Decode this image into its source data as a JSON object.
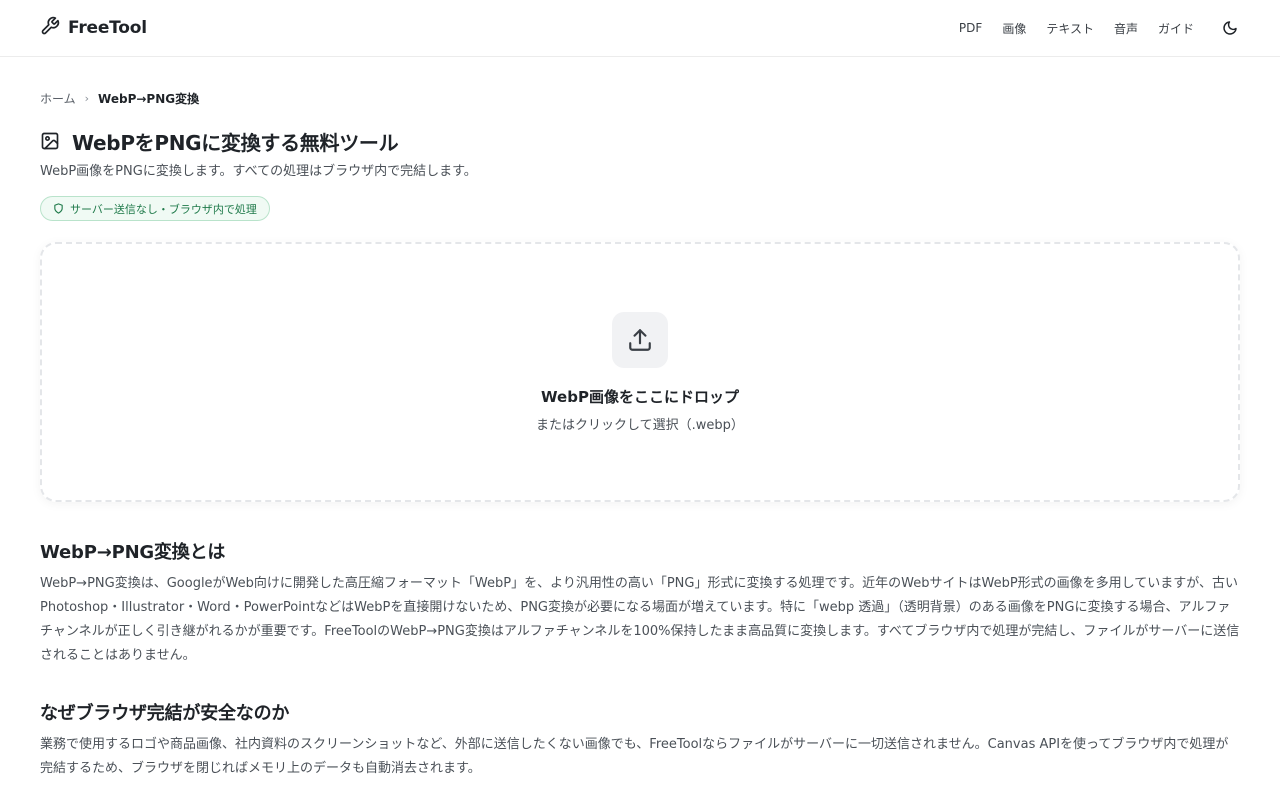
{
  "brand": {
    "name": "FreeTool"
  },
  "nav": {
    "pdf": "PDF",
    "image": "画像",
    "text": "テキスト",
    "audio": "音声",
    "guide": "ガイド"
  },
  "breadcrumb": {
    "home": "ホーム",
    "separator": "›",
    "current": "WebP→PNG変換"
  },
  "page": {
    "title": "WebPをPNGに変換する無料ツール",
    "subtitle": "WebP画像をPNGに変換します。すべての処理はブラウザ内で完結します。",
    "badge": "サーバー送信なし・ブラウザ内で処理"
  },
  "dropzone": {
    "title": "WebP画像をここにドロップ",
    "hint": "またはクリックして選択（.webp）"
  },
  "sections": [
    {
      "title": "WebP→PNG変換とは",
      "body": "WebP→PNG変換は、GoogleがWeb向けに開発した高圧縮フォーマット「WebP」を、より汎用性の高い「PNG」形式に変換する処理です。近年のWebサイトはWebP形式の画像を多用していますが、古いPhotoshop・Illustrator・Word・PowerPointなどはWebPを直接開けないため、PNG変換が必要になる場面が増えています。特に「webp 透過」（透明背景）のある画像をPNGに変換する場合、アルファチャンネルが正しく引き継がれるかが重要です。FreeToolのWebP→PNG変換はアルファチャンネルを100%保持したまま高品質に変換します。すべてブラウザ内で処理が完結し、ファイルがサーバーに送信されることはありません。"
    },
    {
      "title": "なぜブラウザ完結が安全なのか",
      "body": "業務で使用するロゴや商品画像、社内資料のスクリーンショットなど、外部に送信したくない画像でも、FreeToolならファイルがサーバーに一切送信されません。Canvas APIを使ってブラウザ内で処理が完結するため、ブラウザを閉じればメモリ上のデータも自動消去されます。"
    }
  ],
  "colors": {
    "accent": "#1f7a4a",
    "badge_bg": "#f0faf4",
    "text": "#1f2328",
    "muted": "#4a5057"
  },
  "icons": {
    "brand": "wrench-icon",
    "theme": "moon-icon",
    "title": "image-icon",
    "badge": "shield-icon",
    "upload": "upload-icon"
  }
}
